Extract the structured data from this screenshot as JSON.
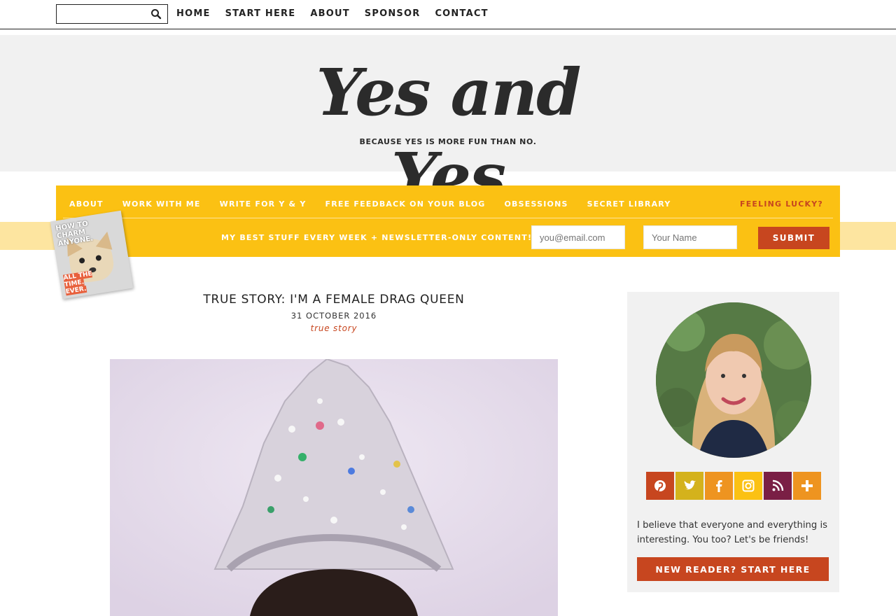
{
  "search": {
    "placeholder": "",
    "icon": "search-icon"
  },
  "top_nav": [
    "HOME",
    "START HERE",
    "ABOUT",
    "SPONSOR",
    "CONTACT"
  ],
  "logo": {
    "title": "Yes and Yes",
    "tagline": "BECAUSE YES IS MORE FUN THAN NO."
  },
  "main_nav": [
    "ABOUT",
    "WORK WITH ME",
    "WRITE FOR Y & Y",
    "FREE FEEDBACK ON YOUR BLOG",
    "OBSESSIONS",
    "SECRET LIBRARY"
  ],
  "feeling_lucky": "FEELING LUCKY?",
  "newsletter": {
    "label": "MY BEST STUFF EVERY WEEK + NEWSLETTER-ONLY CONTENT!",
    "email_placeholder": "you@email.com",
    "name_placeholder": "Your Name",
    "submit_label": "SUBMIT"
  },
  "book": {
    "title": "HOW TO CHARM ANYONE.",
    "subtitle_1": "ALL THE TIME.",
    "subtitle_2": "EVER."
  },
  "post": {
    "title": "TRUE STORY: I'M A FEMALE DRAG QUEEN",
    "date": "31 OCTOBER 2016",
    "category": "true story"
  },
  "sidebar": {
    "social": [
      {
        "name": "pinterest",
        "icon": "pinterest-icon",
        "color": "#c7461f"
      },
      {
        "name": "twitter",
        "icon": "twitter-icon",
        "color": "#d4b21c"
      },
      {
        "name": "facebook",
        "icon": "facebook-icon",
        "color": "#ee9420"
      },
      {
        "name": "instagram",
        "icon": "instagram-icon",
        "color": "#fbc113"
      },
      {
        "name": "rss",
        "icon": "rss-icon",
        "color": "#7a1f45"
      },
      {
        "name": "more",
        "icon": "plus-icon",
        "color": "#ee9420"
      }
    ],
    "bio": "I believe that everyone and everything is interesting. You too? Let's be friends!",
    "start_button": "NEW READER? START HERE"
  },
  "colors": {
    "accent_yellow": "#fbc113",
    "accent_red": "#c7461f",
    "header_bg": "#f1f1f1"
  }
}
